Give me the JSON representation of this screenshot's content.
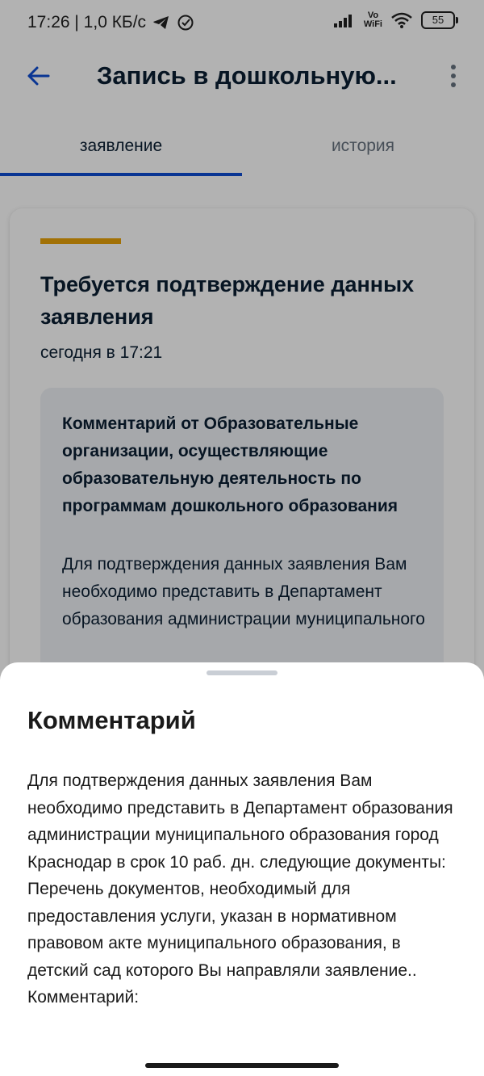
{
  "status_bar": {
    "time_speed": "17:26 | 1,0 КБ/с",
    "vowifi_top": "Vo",
    "vowifi_bottom": "WiFi",
    "battery": "55"
  },
  "header": {
    "title": "Запись в дошкольную..."
  },
  "tabs": [
    {
      "label": "заявление"
    },
    {
      "label": "история"
    }
  ],
  "event": {
    "title": "Требуется подтверждение данных заявления",
    "date": "сегодня в 17:21",
    "comment_author": "Комментарий от Образовательные организации, осуществляющие образовательную деятельность по программам дошкольного образования",
    "comment_text": "Для подтверждения данных заявления Вам необходимо представить в Департамент образования администрации муниципального"
  },
  "sheet": {
    "title": "Комментарий",
    "text": "Для подтверждения данных заявления Вам необходимо представить в Департамент образования администрации муниципального образования город Краснодар в срок 10 раб. дн. следующие документы: Перечень документов, необходимый для предоставления услуги, указан в нормативном правовом акте муниципального образования, в детский сад которого Вы направляли заявление.. Комментарий:"
  },
  "colors": {
    "accent_tab": "#0d4cd3",
    "accent_bar": "#e8a30a",
    "text_primary": "#0b1f33"
  }
}
